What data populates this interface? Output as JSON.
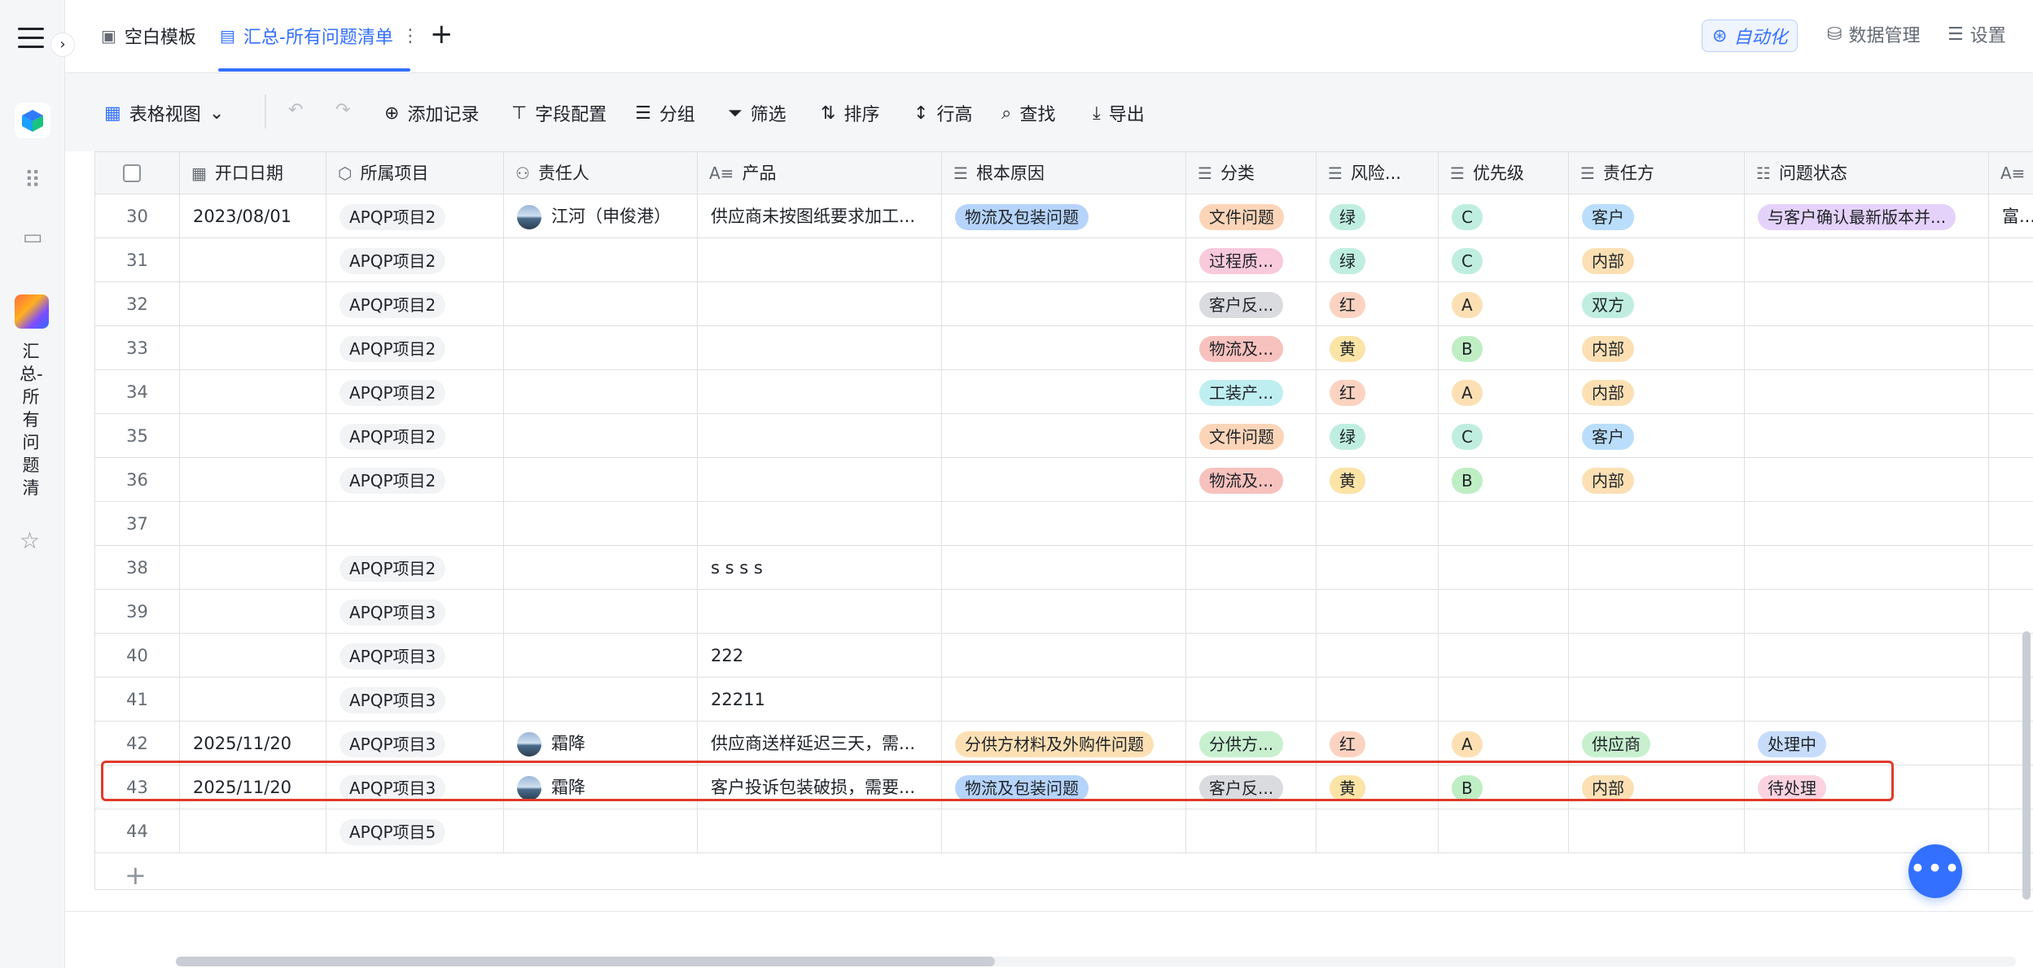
{
  "tabs": [
    {
      "label": "空白模板",
      "icon": "template-icon",
      "active": false
    },
    {
      "label": "汇总-所有问题清单",
      "icon": "document-icon",
      "active": true
    }
  ],
  "topright": {
    "automation": "自动化",
    "data_mgmt": "数据管理",
    "settings": "设置"
  },
  "toolbar": {
    "view": "表格视图",
    "add_record": "添加记录",
    "field_config": "字段配置",
    "group": "分组",
    "filter": "筛选",
    "sort": "排序",
    "row_height": "行高",
    "find": "查找",
    "export": "导出"
  },
  "sidebar": {
    "app_name": "汇总-所有问题清"
  },
  "columns": [
    "开口日期",
    "所属项目",
    "责任人",
    "产品",
    "根本原因",
    "分类",
    "风险...",
    "优先级",
    "责任方",
    "问题状态"
  ],
  "colors": {
    "accent": "#3370ff",
    "highlight": "#e03a2a"
  },
  "rows": [
    {
      "num": "30",
      "date": "2023/08/01",
      "project": "APQP项目2",
      "owner": "江河（申俊港）",
      "product": "供应商未按图纸要求加工...",
      "cause": "物流及包装问题",
      "category": "文件问题",
      "risk": "绿",
      "priority": "C",
      "party": "客户",
      "status": "与客户确认最新版本并...",
      "extra": "富..."
    },
    {
      "num": "31",
      "date": "",
      "project": "APQP项目2",
      "owner": "",
      "product": "",
      "cause": "",
      "category": "过程质...",
      "risk": "绿",
      "priority": "C",
      "party": "内部",
      "status": "",
      "extra": ""
    },
    {
      "num": "32",
      "date": "",
      "project": "APQP项目2",
      "owner": "",
      "product": "",
      "cause": "",
      "category": "客户反...",
      "risk": "红",
      "priority": "A",
      "party": "双方",
      "status": "",
      "extra": ""
    },
    {
      "num": "33",
      "date": "",
      "project": "APQP项目2",
      "owner": "",
      "product": "",
      "cause": "",
      "category": "物流及...",
      "risk": "黄",
      "priority": "B",
      "party": "内部",
      "status": "",
      "extra": ""
    },
    {
      "num": "34",
      "date": "",
      "project": "APQP项目2",
      "owner": "",
      "product": "",
      "cause": "",
      "category": "工装产...",
      "risk": "红",
      "priority": "A",
      "party": "内部",
      "status": "",
      "extra": ""
    },
    {
      "num": "35",
      "date": "",
      "project": "APQP项目2",
      "owner": "",
      "product": "",
      "cause": "",
      "category": "文件问题",
      "risk": "绿",
      "priority": "C",
      "party": "客户",
      "status": "",
      "extra": ""
    },
    {
      "num": "36",
      "date": "",
      "project": "APQP项目2",
      "owner": "",
      "product": "",
      "cause": "",
      "category": "物流及...",
      "risk": "黄",
      "priority": "B",
      "party": "内部",
      "status": "",
      "extra": ""
    },
    {
      "num": "37",
      "date": "",
      "project": "",
      "owner": "",
      "product": "",
      "cause": "",
      "category": "",
      "risk": "",
      "priority": "",
      "party": "",
      "status": "",
      "extra": ""
    },
    {
      "num": "38",
      "date": "",
      "project": "APQP项目2",
      "owner": "",
      "product": "s s s s",
      "cause": "",
      "category": "",
      "risk": "",
      "priority": "",
      "party": "",
      "status": "",
      "extra": ""
    },
    {
      "num": "39",
      "date": "",
      "project": "APQP项目3",
      "owner": "",
      "product": "",
      "cause": "",
      "category": "",
      "risk": "",
      "priority": "",
      "party": "",
      "status": "",
      "extra": ""
    },
    {
      "num": "40",
      "date": "",
      "project": "APQP项目3",
      "owner": "",
      "product": "222",
      "cause": "",
      "category": "",
      "risk": "",
      "priority": "",
      "party": "",
      "status": "",
      "extra": ""
    },
    {
      "num": "41",
      "date": "",
      "project": "APQP项目3",
      "owner": "",
      "product": "22211",
      "cause": "",
      "category": "",
      "risk": "",
      "priority": "",
      "party": "",
      "status": "",
      "extra": ""
    },
    {
      "num": "42",
      "date": "2025/11/20",
      "project": "APQP项目3",
      "owner": "霜降",
      "product": "供应商送样延迟三天，需...",
      "cause": "分供方材料及外购件问题",
      "category": "分供方...",
      "risk": "红",
      "priority": "A",
      "party": "供应商",
      "status": "处理中",
      "extra": ""
    },
    {
      "num": "43",
      "date": "2025/11/20",
      "project": "APQP项目3",
      "owner": "霜降",
      "product": "客户投诉包装破损，需要...",
      "cause": "物流及包装问题",
      "category": "客户反...",
      "risk": "黄",
      "priority": "B",
      "party": "内部",
      "status": "待处理",
      "extra": ""
    },
    {
      "num": "44",
      "date": "",
      "project": "APQP项目5",
      "owner": "",
      "product": "",
      "cause": "",
      "category": "",
      "risk": "",
      "priority": "",
      "party": "",
      "status": "",
      "extra": ""
    }
  ]
}
